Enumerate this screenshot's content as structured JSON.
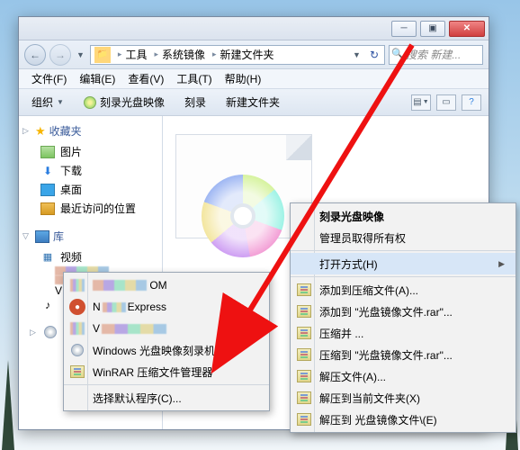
{
  "window": {
    "minimize": "─",
    "maximize": "▣",
    "close": "✕"
  },
  "nav": {
    "back": "←",
    "forward": "→",
    "breadcrumbs": [
      "工具",
      "系统镜像",
      "新建文件夹"
    ],
    "refresh": "↻",
    "search_placeholder": "搜索 新建..."
  },
  "menu": {
    "file": "文件(F)",
    "edit": "编辑(E)",
    "view": "查看(V)",
    "tools": "工具(T)",
    "help": "帮助(H)"
  },
  "toolbar": {
    "organize": "组织",
    "burn_image": "刻录光盘映像",
    "burn": "刻录",
    "new_folder": "新建文件夹"
  },
  "sidebar": {
    "favorites": "收藏夹",
    "fav_items": {
      "pictures": "图片",
      "downloads": "下载",
      "desktop": "桌面",
      "recent": "最近访问的位置"
    },
    "library": "库",
    "lib_items": {
      "video": "视频",
      "video_sub": "V"
    },
    "music_icon": "♪"
  },
  "ctx_right": {
    "burn_image": "刻录光盘映像",
    "admin_own": "管理员取得所有权",
    "open_with": "打开方式(H)",
    "add_to_archive": "添加到压缩文件(A)...",
    "add_to_rar": "添加到 \"光盘镜像文件.rar\"...",
    "compress_and": "压缩并 ...",
    "compress_to_rar": "压缩到 \"光盘镜像文件.rar\"...",
    "extract": "解压文件(A)...",
    "extract_here": "解压到当前文件夹(X)",
    "extract_to": "解压到 光盘镜像文件\\(E)"
  },
  "ctx_left": {
    "app1_suffix": "OM",
    "nero": "N",
    "express_suffix": "Express",
    "vi": "V",
    "windows_burner": "Windows 光盘映像刻录机",
    "winrar": "WinRAR 压缩文件管理器",
    "choose_default": "选择默认程序(C)..."
  },
  "annotation": {
    "color": "#e11"
  }
}
